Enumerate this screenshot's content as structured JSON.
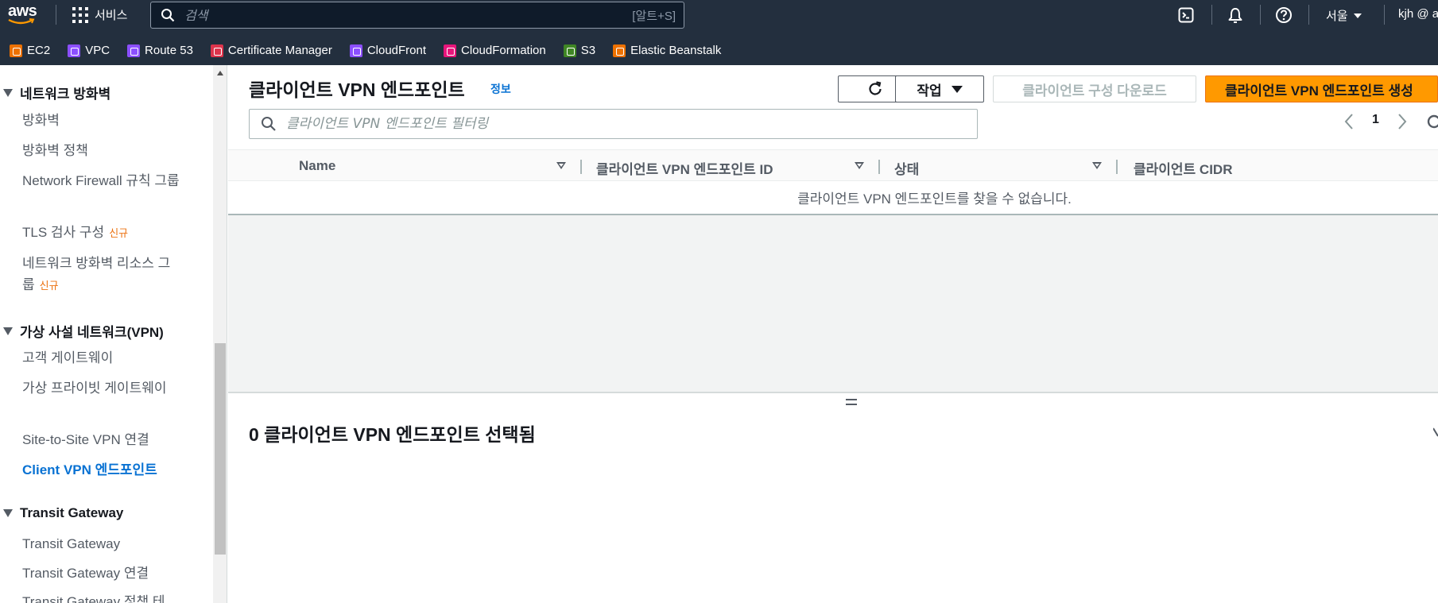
{
  "topnav": {
    "logo_text": "aws",
    "services_label": "서비스",
    "search_placeholder": "검색",
    "search_shortcut": "[알트+S]",
    "region": "서울",
    "account": "kjh @ a"
  },
  "favorites": [
    {
      "label": "EC2",
      "color": "#ed7100"
    },
    {
      "label": "VPC",
      "color": "#8c4fff"
    },
    {
      "label": "Route 53",
      "color": "#8c4fff"
    },
    {
      "label": "Certificate Manager",
      "color": "#dd344c"
    },
    {
      "label": "CloudFront",
      "color": "#8c4fff"
    },
    {
      "label": "CloudFormation",
      "color": "#e7157b"
    },
    {
      "label": "S3",
      "color": "#3f8624"
    },
    {
      "label": "Elastic Beanstalk",
      "color": "#ed7100"
    }
  ],
  "sidebar": {
    "section_firewall": "네트워크 방화벽",
    "firewall": "방화벽",
    "firewall_policy": "방화벽 정책",
    "nf_rule_group": "Network Firewall 규칙 그룹",
    "tls_inspection": "TLS 검사 구성",
    "new_badge": "신규",
    "nf_resource_group": "네트워크 방화벽 리소스 그룹",
    "section_vpn": "가상 사설 네트워크(VPN)",
    "customer_gateway": "고객 게이트웨이",
    "virtual_private_gateway": "가상 프라이빗 게이트웨이",
    "site_to_site": "Site-to-Site VPN 연결",
    "client_vpn": "Client VPN 엔드포인트",
    "section_tgw": "Transit Gateway",
    "tgw": "Transit Gateway",
    "tgw_attach": "Transit Gateway 연결",
    "tgw_policy": "Transit Gateway 정책 테"
  },
  "main": {
    "title": "클라이언트 VPN 엔드포인트",
    "info": "정보",
    "actions_label": "작업",
    "download_config": "클라이언트 구성 다운로드",
    "create": "클라이언트 VPN 엔드포인트 생성",
    "filter_placeholder": "클라이언트 VPN 엔드포인트 필터링",
    "page_number": "1",
    "columns": [
      "Name",
      "클라이언트 VPN 엔드포인트 ID",
      "상태",
      "클라이언트 CIDR"
    ],
    "empty_message": "클라이언트 VPN 엔드포인트를 찾을 수 없습니다.",
    "selected_title": "0 클라이언트 VPN 엔드포인트 선택됨"
  },
  "colors": {
    "nav_bg": "#232f3e",
    "primary": "#ff9900",
    "link": "#0972d3",
    "new_badge": "#ec7211"
  }
}
